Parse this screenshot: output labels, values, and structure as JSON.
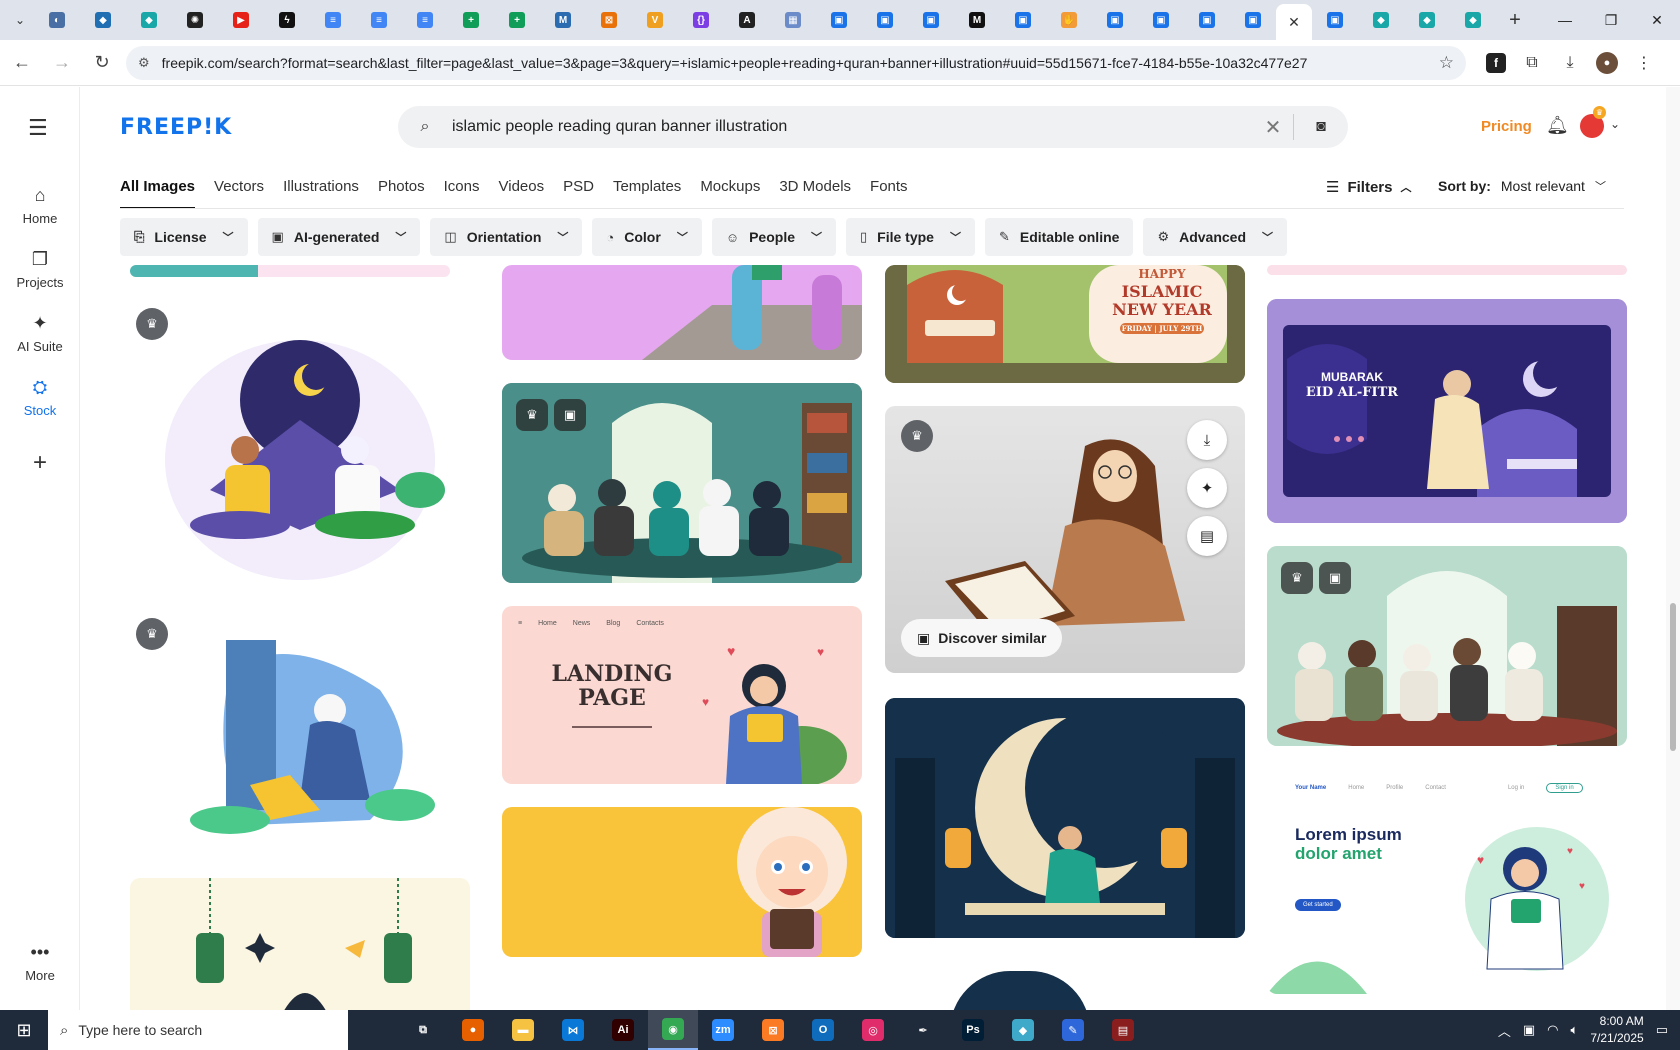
{
  "browser": {
    "tabs": [
      {
        "icon": "circle-icon",
        "color": "#4a6fa5",
        "glyph": "◐"
      },
      {
        "icon": "shield-icon",
        "color": "#1f6fb2",
        "glyph": "◆"
      },
      {
        "icon": "hex-icon",
        "color": "#1aa7a7",
        "glyph": "◆"
      },
      {
        "icon": "chatgpt-icon",
        "color": "#222222",
        "glyph": "✺"
      },
      {
        "icon": "youtube-icon",
        "color": "#e62117",
        "glyph": "▶"
      },
      {
        "icon": "bolt-icon",
        "color": "#111111",
        "glyph": "ϟ"
      },
      {
        "icon": "docs-icon",
        "color": "#4285f4",
        "glyph": "≡"
      },
      {
        "icon": "docs-icon",
        "color": "#4285f4",
        "glyph": "≡"
      },
      {
        "icon": "docs-icon",
        "color": "#4285f4",
        "glyph": "≡"
      },
      {
        "icon": "sheets-icon",
        "color": "#0f9d58",
        "glyph": "+"
      },
      {
        "icon": "sheets-icon",
        "color": "#0f9d58",
        "glyph": "+"
      },
      {
        "icon": "m-icon",
        "color": "#2b6cb0",
        "glyph": "M"
      },
      {
        "icon": "box-icon",
        "color": "#e8710a",
        "glyph": "⊠"
      },
      {
        "icon": "v-icon",
        "color": "#f0a020",
        "glyph": "V"
      },
      {
        "icon": "braces-icon",
        "color": "#7b3fe4",
        "glyph": "{}"
      },
      {
        "icon": "a-icon",
        "color": "#222222",
        "glyph": "A"
      },
      {
        "icon": "grid-icon",
        "color": "#6b8cc9",
        "glyph": "▦"
      },
      {
        "icon": "doc-blue-icon",
        "color": "#1a73e8",
        "glyph": "▣"
      },
      {
        "icon": "doc-blue-icon",
        "color": "#1a73e8",
        "glyph": "▣"
      },
      {
        "icon": "doc-blue-icon",
        "color": "#1a73e8",
        "glyph": "▣"
      },
      {
        "icon": "medium-icon",
        "color": "#111111",
        "glyph": "M"
      },
      {
        "icon": "doc-blue-icon",
        "color": "#1a73e8",
        "glyph": "▣"
      },
      {
        "icon": "hand-icon",
        "color": "#f29b38",
        "glyph": "✋"
      },
      {
        "icon": "doc-blue-icon",
        "color": "#1a73e8",
        "glyph": "▣"
      },
      {
        "icon": "doc-blue-icon",
        "color": "#1a73e8",
        "glyph": "▣"
      },
      {
        "icon": "doc-blue-icon",
        "color": "#1a73e8",
        "glyph": "▣"
      },
      {
        "icon": "doc-blue-icon",
        "color": "#1a73e8",
        "glyph": "▣"
      }
    ],
    "active_tab_close": "✕",
    "tabs_after": [
      {
        "icon": "doc-blue-icon",
        "color": "#1a73e8",
        "glyph": "▣"
      },
      {
        "icon": "hex-icon",
        "color": "#1aa7a7",
        "glyph": "◆"
      },
      {
        "icon": "hex-icon",
        "color": "#1aa7a7",
        "glyph": "◆"
      },
      {
        "icon": "hex-icon",
        "color": "#1aa7a7",
        "glyph": "◆"
      }
    ],
    "url": "freepik.com/search?format=search&last_filter=page&last_value=3&page=3&query=+islamic+people+reading+quran+banner+illustration#uuid=55d15671-fce7-4184-b55e-10a32c477e27"
  },
  "sidebar": {
    "items": [
      {
        "label": "Home",
        "icon": "home-icon",
        "glyph": "⌂"
      },
      {
        "label": "Projects",
        "icon": "projects-icon",
        "glyph": "❐"
      },
      {
        "label": "AI Suite",
        "icon": "ai-suite-icon",
        "glyph": "✦"
      },
      {
        "label": "Stock",
        "icon": "stock-icon",
        "glyph": "⛭"
      }
    ],
    "more_label": "More"
  },
  "header": {
    "logo": "FREEP!K",
    "search_value": "islamic people reading quran banner illustration",
    "pricing": "Pricing"
  },
  "categories": [
    "All Images",
    "Vectors",
    "Illustrations",
    "Photos",
    "Icons",
    "Videos",
    "PSD",
    "Templates",
    "Mockups",
    "3D Models",
    "Fonts"
  ],
  "filters_label": "Filters",
  "sort": {
    "label": "Sort by:",
    "value": "Most relevant"
  },
  "filter_chips": [
    {
      "label": "License",
      "icon": "license-icon",
      "glyph": "⎘"
    },
    {
      "label": "AI-generated",
      "icon": "ai-generated-icon",
      "glyph": "▣"
    },
    {
      "label": "Orientation",
      "icon": "orientation-icon",
      "glyph": "◫"
    },
    {
      "label": "Color",
      "icon": "palette-icon",
      "glyph": "◔"
    },
    {
      "label": "People",
      "icon": "people-icon",
      "glyph": "☺"
    },
    {
      "label": "File type",
      "icon": "file-icon",
      "glyph": "▯"
    },
    {
      "label": "Editable online",
      "icon": "pencil-icon",
      "glyph": "✎"
    },
    {
      "label": "Advanced",
      "icon": "settings-icon",
      "glyph": "⚙"
    }
  ],
  "cards": {
    "islamic_new_year": {
      "line1": "HAPPY",
      "line2": "ISLAMIC",
      "line3": "NEW YEAR",
      "date": "FRIDAY | JULY 29TH"
    },
    "landing_page": {
      "title1": "LANDING",
      "title2": "PAGE",
      "nav": [
        "Home",
        "News",
        "Blog",
        "Contacts"
      ]
    },
    "eid": {
      "line1": "MUBARAK",
      "line2": "EID AL-FITR"
    },
    "lorem": {
      "title1": "Lorem ipsum",
      "title2": "dolor amet",
      "brand": "Your Name",
      "nav": [
        "Home",
        "Profile",
        "Contact",
        "Log in"
      ],
      "signup": "Sign in",
      "cta": "Get started"
    },
    "discover_similar": "Discover similar"
  },
  "taskbar": {
    "search_placeholder": "Type here to search",
    "time": "8:00 AM",
    "date": "7/21/2025",
    "apps": [
      {
        "icon": "task-view-icon",
        "color": "#1f2a3a",
        "glyph": "⧉"
      },
      {
        "icon": "firefox-icon",
        "color": "#e66000",
        "glyph": "●"
      },
      {
        "icon": "file-explorer-icon",
        "color": "#f5c242",
        "glyph": "▬"
      },
      {
        "icon": "vscode-icon",
        "color": "#0a78d7",
        "glyph": "⋈"
      },
      {
        "icon": "illustrator-icon",
        "color": "#300000",
        "glyph": "Ai"
      },
      {
        "icon": "chrome-icon",
        "color": "#34a853",
        "glyph": "◉"
      },
      {
        "icon": "zoom-icon",
        "color": "#2d8cff",
        "glyph": "zm"
      },
      {
        "icon": "xampp-icon",
        "color": "#fb7a24",
        "glyph": "⊠"
      },
      {
        "icon": "outlook-icon",
        "color": "#0f6cbd",
        "glyph": "O"
      },
      {
        "icon": "creative-cloud-icon",
        "color": "#e02c6b",
        "glyph": "◎"
      },
      {
        "icon": "pen-tool-icon",
        "color": "#1f2a3a",
        "glyph": "✒"
      },
      {
        "icon": "photoshop-icon",
        "color": "#001e36",
        "glyph": "Ps"
      },
      {
        "icon": "box3d-icon",
        "color": "#3fa9c9",
        "glyph": "◆"
      },
      {
        "icon": "paint-icon",
        "color": "#2d67d9",
        "glyph": "✎"
      },
      {
        "icon": "winrar-icon",
        "color": "#8a1e1e",
        "glyph": "▤"
      }
    ]
  },
  "colors": {
    "brand": "#1273eb",
    "pricing": "#f08a24",
    "avatar": "#e53935"
  }
}
